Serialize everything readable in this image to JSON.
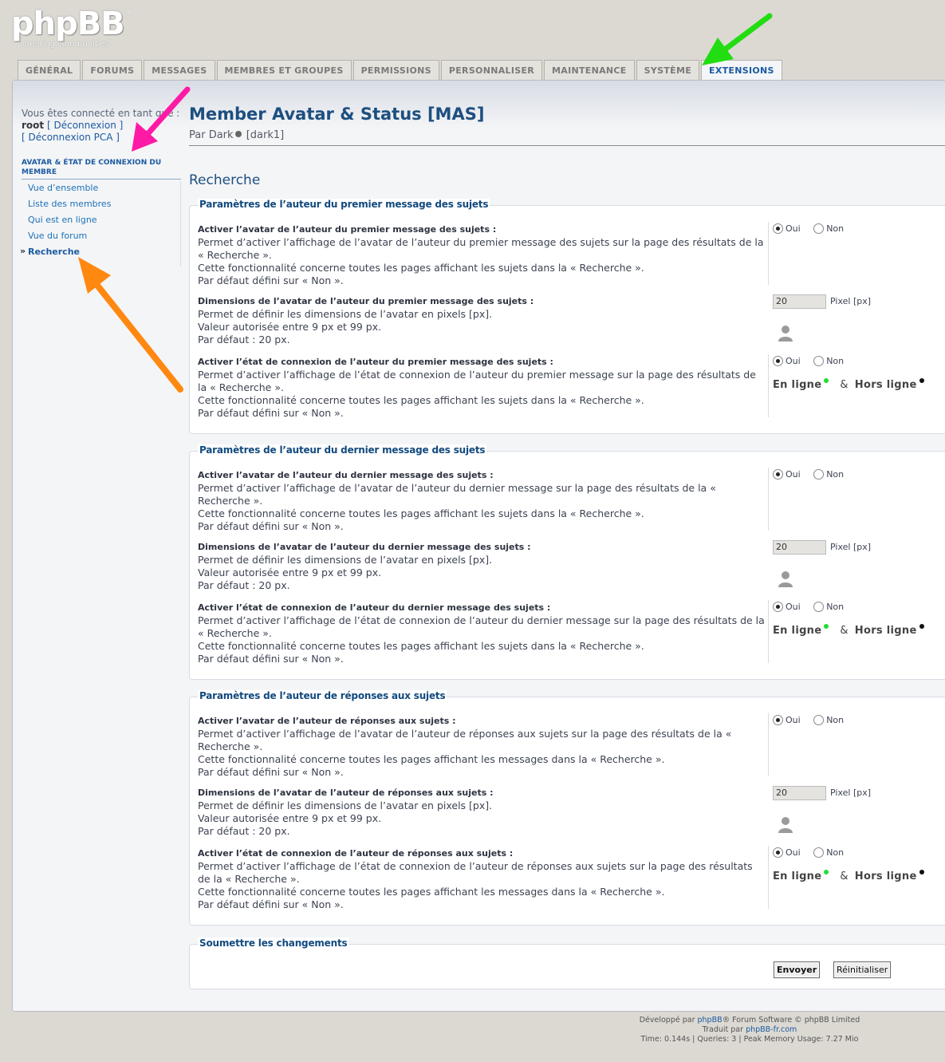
{
  "logo": {
    "name": "phpBB",
    "reg": "®",
    "tagline": "creating communities"
  },
  "tabs": [
    {
      "label": "GÉNÉRAL",
      "active": false
    },
    {
      "label": "FORUMS",
      "active": false
    },
    {
      "label": "MESSAGES",
      "active": false
    },
    {
      "label": "MEMBRES ET GROUPES",
      "active": false
    },
    {
      "label": "PERMISSIONS",
      "active": false
    },
    {
      "label": "PERSONNALISER",
      "active": false
    },
    {
      "label": "MAINTENANCE",
      "active": false
    },
    {
      "label": "SYSTÈME",
      "active": false
    },
    {
      "label": "EXTENSIONS",
      "active": true
    }
  ],
  "sidebar": {
    "login_prefix": "Vous êtes connecté en tant que :",
    "username": "root",
    "logout": "[ Déconnexion ]",
    "logout_acp": "[ Déconnexion PCA ]",
    "menu_header": "AVATAR & ÉTAT DE CONNEXION DU MEMBRE",
    "items": [
      {
        "label": "Vue d’ensemble",
        "active": false
      },
      {
        "label": "Liste des membres",
        "active": false
      },
      {
        "label": "Qui est en ligne",
        "active": false
      },
      {
        "label": "Vue du forum",
        "active": false
      },
      {
        "label": "Recherche",
        "active": true
      }
    ]
  },
  "main": {
    "title": "Member Avatar & Status [MAS]",
    "by_prefix": "Par Dark",
    "by_suffix": "[dark1]",
    "section_title": "Recherche",
    "fieldsets": [
      {
        "legend": "Paramètres de l’auteur du premier message des sujets",
        "avatar_enable": {
          "title": "Activer l’avatar de l’auteur du premier message des sujets :",
          "lines": [
            "Permet d’activer l’affichage de l’avatar de l’auteur du premier message des sujets sur la page des résultats de la « Recherche ».",
            "Cette fonctionnalité concerne toutes les pages affichant les sujets dans la « Recherche ».",
            "Par défaut défini sur « Non »."
          ]
        },
        "avatar_size": {
          "title": "Dimensions de l’avatar de l’auteur du premier message des sujets :",
          "lines": [
            "Permet de définir les dimensions de l’avatar en pixels [px].",
            "Valeur autorisée entre 9 px et 99 px.",
            "Par défaut : 20 px."
          ],
          "value": "20"
        },
        "status_enable": {
          "title": "Activer l’état de connexion de l’auteur du premier message des sujets :",
          "lines": [
            "Permet d’activer l’affichage de l’état de connexion de l’auteur du premier message sur la page des résultats de la « Recherche ».",
            "Cette fonctionnalité concerne toutes les pages affichant les sujets dans la « Recherche ».",
            "Par défaut défini sur « Non »."
          ]
        }
      },
      {
        "legend": "Paramètres de l’auteur du dernier message des sujets",
        "avatar_enable": {
          "title": "Activer l’avatar de l’auteur du dernier message des sujets :",
          "lines": [
            "Permet d’activer l’affichage de l’avatar de l’auteur du dernier message sur la page des résultats de la « Recherche ».",
            "Cette fonctionnalité concerne toutes les pages affichant les sujets dans la « Recherche ».",
            "Par défaut défini sur « Non »."
          ]
        },
        "avatar_size": {
          "title": "Dimensions de l’avatar de l’auteur du dernier message des sujets :",
          "lines": [
            "Permet de définir les dimensions de l’avatar en pixels [px].",
            "Valeur autorisée entre 9 px et 99 px.",
            "Par défaut : 20 px."
          ],
          "value": "20"
        },
        "status_enable": {
          "title": "Activer l’état de connexion de l’auteur du dernier message des sujets :",
          "lines": [
            "Permet d’activer l’affichage de l’état de connexion de l’auteur du dernier message sur la page des résultats de la « Recherche ».",
            "Cette fonctionnalité concerne toutes les pages affichant les sujets dans la « Recherche ».",
            "Par défaut défini sur « Non »."
          ]
        }
      },
      {
        "legend": "Paramètres de l’auteur de réponses aux sujets",
        "avatar_enable": {
          "title": "Activer l’avatar de l’auteur de réponses aux sujets :",
          "lines": [
            "Permet d’activer l’affichage de l’avatar de l’auteur de réponses aux sujets sur la page des résultats de la « Recherche ».",
            "Cette fonctionnalité concerne toutes les pages affichant les messages dans la « Recherche ».",
            "Par défaut défini sur « Non »."
          ]
        },
        "avatar_size": {
          "title": "Dimensions de l’avatar de l’auteur de réponses aux sujets :",
          "lines": [
            "Permet de définir les dimensions de l’avatar en pixels [px].",
            "Valeur autorisée entre 9 px et 99 px.",
            "Par défaut : 20 px."
          ],
          "value": "20"
        },
        "status_enable": {
          "title": "Activer l’état de connexion de l’auteur de réponses aux sujets :",
          "lines": [
            "Permet d’activer l’affichage de l’état de connexion de l’auteur de réponses aux sujets sur la page des résultats de la « Recherche ».",
            "Cette fonctionnalité concerne toutes les pages affichant les messages dans la « Recherche ».",
            "Par défaut défini sur « Non »."
          ]
        }
      }
    ],
    "radio_yes": "Oui",
    "radio_no": "Non",
    "px_unit": "Pixel [px]",
    "online": "En ligne",
    "amp": "&",
    "offline": "Hors ligne",
    "submit_legend": "Soumettre les changements",
    "submit": "Envoyer",
    "reset": "Réinitialiser"
  },
  "footer": {
    "line1_pre": "Développé par ",
    "line1_link": "phpBB",
    "line1_post": "® Forum Software © phpBB Limited",
    "line2_pre": "Traduit par ",
    "line2_link": "phpBB-fr.com",
    "line3": "Time: 0.144s | Queries: 3 | Peak Memory Usage: 7.27 Mio"
  },
  "annotations": {
    "arrow_colors": [
      "#22dd11",
      "#ff1aa6",
      "#ff8811"
    ]
  }
}
